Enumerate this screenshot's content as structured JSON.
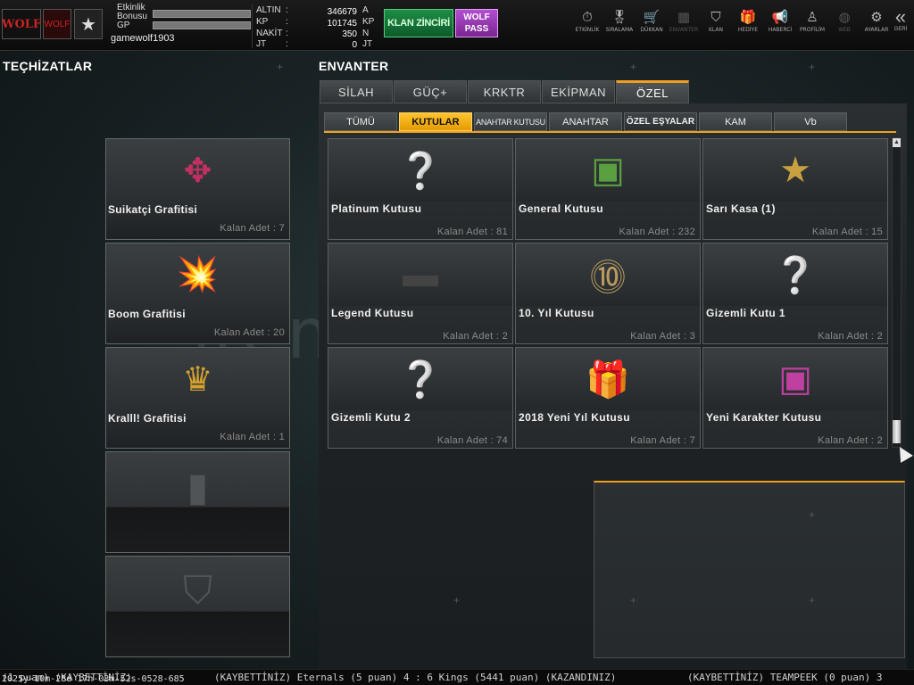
{
  "profile": {
    "logo_text": "WOLF",
    "clan_logo_text": "WOLF",
    "rank_icon": "star-icon",
    "event_bonus_label": "Etkinlik\nBonusu",
    "gp_label": "GP",
    "username": "gamewolf1903"
  },
  "currency": [
    {
      "label": "ALTIN",
      "value": "346679",
      "unit": "A"
    },
    {
      "label": "KP",
      "value": "101745",
      "unit": "KP"
    },
    {
      "label": "NAKİT",
      "value": "350",
      "unit": "N"
    },
    {
      "label": "JT",
      "value": "0",
      "unit": "JT"
    }
  ],
  "buttons": {
    "klan_chain": "KLAN ZİNCİRİ",
    "wolf_pass_1": "WOLF",
    "wolf_pass_2": "PASS"
  },
  "nav": [
    {
      "label": "ETKİNLİK",
      "icon": "stopwatch-icon",
      "glyph": "⏱",
      "active": true
    },
    {
      "label": "SIRALAMA",
      "icon": "medal-icon",
      "glyph": "🎖",
      "active": true
    },
    {
      "label": "DÜKKAN",
      "icon": "cart-icon",
      "glyph": "🛒",
      "active": true
    },
    {
      "label": "ENVANTER",
      "icon": "inventory-icon",
      "glyph": "▦",
      "active": false
    },
    {
      "label": "KLAN",
      "icon": "shield-icon",
      "glyph": "⛉",
      "active": true
    },
    {
      "label": "HEDİYE",
      "icon": "gift-icon",
      "glyph": "🎁",
      "active": true
    },
    {
      "label": "HABERCİ",
      "icon": "megaphone-icon",
      "glyph": "📢",
      "active": true
    },
    {
      "label": "PROFİLİM",
      "icon": "profile-icon",
      "glyph": "♙",
      "active": true
    },
    {
      "label": "WEB",
      "icon": "globe-icon",
      "glyph": "◍",
      "active": false
    },
    {
      "label": "AYARLAR",
      "icon": "gear-icon",
      "glyph": "⚙",
      "active": true
    }
  ],
  "back": {
    "label": "GERİ",
    "glyph": "«"
  },
  "left": {
    "title": "TEÇHİZATLAR",
    "cards": [
      {
        "name": "Suikatçi Grafitisi",
        "count": "Kalan Adet : 7",
        "icon": "assassin-graffiti-icon",
        "glyph": "✥",
        "color": "#c03060"
      },
      {
        "name": "Boom Grafitisi",
        "count": "Kalan Adet : 20",
        "icon": "boom-graffiti-icon",
        "glyph": "💥",
        "color": "#e08020"
      },
      {
        "name": "Kralll! Grafitisi",
        "count": "Kalan Adet : 1",
        "icon": "king-graffiti-icon",
        "glyph": "♛",
        "color": "#d4a030"
      }
    ],
    "empty_slots": [
      {
        "icon": "spray-can-icon",
        "glyph": "▮"
      },
      {
        "icon": "shield-icon",
        "glyph": "⛉"
      }
    ]
  },
  "inventory": {
    "title": "ENVANTER",
    "main_tabs": [
      "SİLAH",
      "GÜÇ+",
      "KRKTR",
      "EKİPMAN",
      "ÖZEL"
    ],
    "active_main_tab": 4,
    "sub_tabs": [
      "TÜMÜ",
      "KUTULAR",
      "ANAHTAR KUTUSU",
      "ANAHTAR",
      "ÖZEL EŞYALAR",
      "KAM",
      "Vb"
    ],
    "active_sub_tab": 1,
    "items": [
      {
        "name": "Platinum Kutusu",
        "count": "Kalan Adet : 81",
        "icon": "platinum-box-icon",
        "glyph": "❔",
        "color": "#dfe3e6"
      },
      {
        "name": "General Kutusu",
        "count": "Kalan Adet : 232",
        "icon": "general-box-icon",
        "glyph": "▣",
        "color": "#5aa040"
      },
      {
        "name": "Sarı Kasa (1)",
        "count": "Kalan Adet : 15",
        "icon": "yellow-crate-icon",
        "glyph": "★",
        "color": "#c9a040"
      },
      {
        "name": "Legend Kutusu",
        "count": "Kalan Adet : 2",
        "icon": "legend-box-icon",
        "glyph": "▬",
        "color": "#444"
      },
      {
        "name": "10. Yıl Kutusu",
        "count": "Kalan Adet : 3",
        "icon": "anniversary-box-icon",
        "glyph": "⓾",
        "color": "#b89a60"
      },
      {
        "name": "Gizemli Kutu 1",
        "count": "Kalan Adet : 2",
        "icon": "mystery-box-icon",
        "glyph": "❔",
        "color": "#8fb050"
      },
      {
        "name": "Gizemli Kutu 2",
        "count": "Kalan Adet : 74",
        "icon": "mystery-box-icon",
        "glyph": "❔",
        "color": "#8fb050"
      },
      {
        "name": "2018 Yeni Yıl Kutusu",
        "count": "Kalan Adet : 7",
        "icon": "new-year-gift-icon",
        "glyph": "🎁",
        "color": "#c03030"
      },
      {
        "name": "Yeni Karakter Kutusu",
        "count": "Kalan Adet : 2",
        "icon": "character-box-icon",
        "glyph": "▣",
        "color": "#c040a0"
      }
    ]
  },
  "watermark": "itemsatis",
  "ticker": {
    "part1": "(1 puan) (KAYBETTİNİZ)",
    "part2": "(KAYBETTİNİZ) Eternals (5 puan) 4 : 6 Kings (5441 puan) (KAZANDINIZ)",
    "part3": "(KAYBETTİNİZ) TEAMPEEK (0 puan) 3"
  },
  "timestamp": "2025y-10m-28d 17h-03m-52s-0528-685"
}
